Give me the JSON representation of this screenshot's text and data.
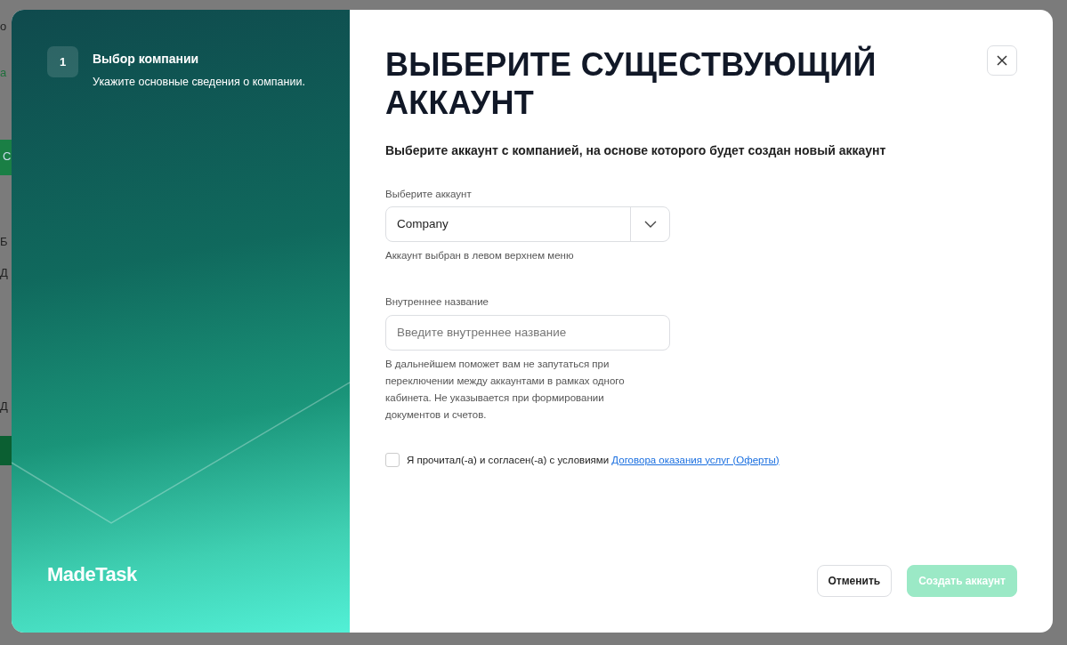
{
  "background_page": {
    "fragments": [
      {
        "text": "о",
        "kind": "text"
      },
      {
        "text": "а",
        "kind": "link"
      },
      {
        "text": "С",
        "kind": "button"
      },
      {
        "text": "Б",
        "kind": "text"
      },
      {
        "text": "Д",
        "kind": "text"
      },
      {
        "text": "Д",
        "kind": "text"
      },
      {
        "kind": "bar"
      }
    ]
  },
  "sidebar": {
    "steps": [
      {
        "number": "1",
        "title": "Выбор компании",
        "description": "Укажите основные сведения о компании."
      }
    ],
    "logo": "MadeTask"
  },
  "dialog": {
    "title": "ВЫБЕРИТЕ СУЩЕСТВУЮЩИЙ АККАУНТ",
    "subtitle": "Выберите аккаунт с компанией, на основе которого будет создан новый аккаунт",
    "fields": [
      {
        "kind": "select",
        "label": "Выберите аккаунт",
        "value": "Company",
        "hint": "Аккаунт выбран в левом верхнем меню"
      },
      {
        "kind": "text",
        "label": "Внутреннее название",
        "placeholder": "Введите внутреннее название",
        "hint": "В дальнейшем поможет вам не запутаться при переключении между аккаунтами в рамках одного кабинета. Не указывается при формировании документов и счетов."
      }
    ],
    "agreement": {
      "checked": false,
      "text": "Я прочитал(-а) и согласен(-а) с условиями",
      "link": "Договора оказания услуг (Оферты)"
    },
    "buttons": [
      {
        "label": "Отменить",
        "kind": "secondary",
        "disabled": false
      },
      {
        "label": "Создать аккаунт",
        "kind": "primary",
        "disabled": true
      }
    ]
  }
}
